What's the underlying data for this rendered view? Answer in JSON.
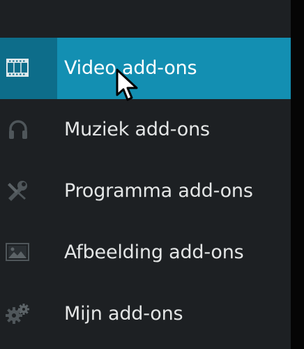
{
  "menu": {
    "items": [
      {
        "label": "Video add-ons",
        "icon": "film-icon",
        "active": true
      },
      {
        "label": "Muziek add-ons",
        "icon": "headphones-icon",
        "active": false
      },
      {
        "label": "Programma add-ons",
        "icon": "tools-icon",
        "active": false
      },
      {
        "label": "Afbeelding add-ons",
        "icon": "picture-icon",
        "active": false
      },
      {
        "label": "Mijn add-ons",
        "icon": "gears-icon",
        "active": false
      }
    ]
  },
  "colors": {
    "background": "#070707",
    "panel": "#1d2023",
    "accent": "#138fb2",
    "accent_dark": "#0d6d8a",
    "text": "#e4e6e6",
    "icon": "#5c6367"
  }
}
